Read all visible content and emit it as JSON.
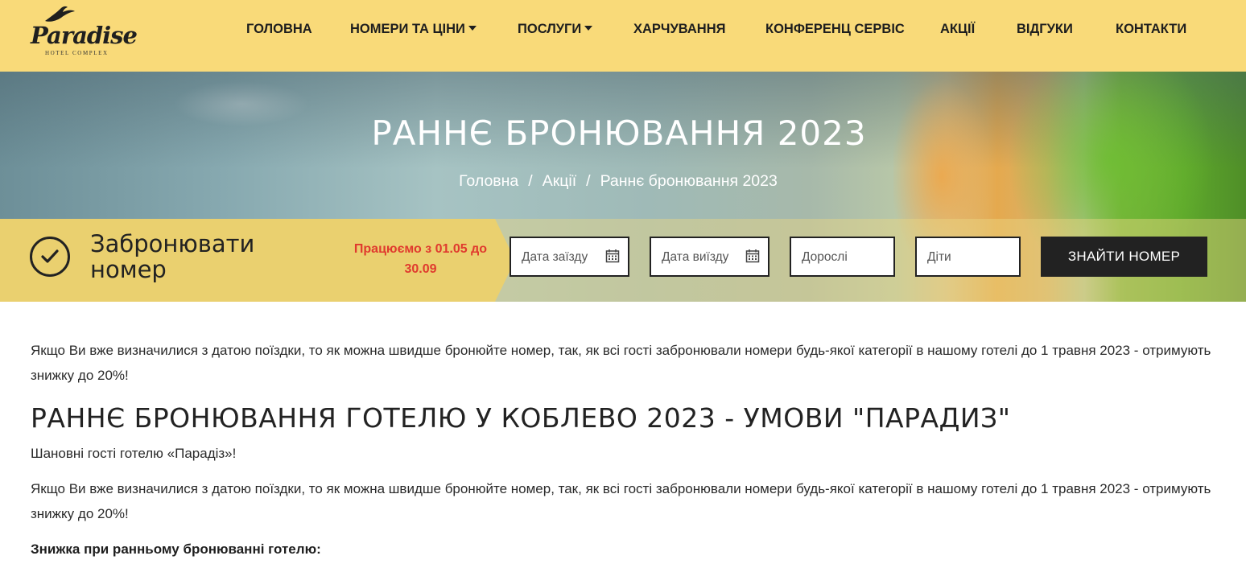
{
  "header": {
    "logo": {
      "word": "Paradise",
      "sub": "HOTEL COMPLEX"
    },
    "nav": [
      {
        "label": "ГОЛОВНА",
        "has_dropdown": false
      },
      {
        "label": "НОМЕРИ ТА ЦІНИ",
        "has_dropdown": true
      },
      {
        "label": "ПОСЛУГИ",
        "has_dropdown": true
      },
      {
        "label": "ХАРЧУВАННЯ",
        "has_dropdown": false
      },
      {
        "label": "КОНФЕРЕНЦ СЕРВІС",
        "has_dropdown": false
      },
      {
        "label": "АКЦІЇ",
        "has_dropdown": false
      },
      {
        "label": "ВІДГУКИ",
        "has_dropdown": false
      },
      {
        "label": "КОНТАКТИ",
        "has_dropdown": false
      }
    ]
  },
  "hero": {
    "title": "РАННЄ БРОНЮВАННЯ 2023",
    "breadcrumb": [
      "Головна",
      "Акції",
      "Раннє бронювання 2023"
    ],
    "separator": "/"
  },
  "booking": {
    "title_line1": "Забронювати",
    "title_line2": "номер",
    "notice": "Працюємо з 01.05 до 30.09",
    "checkin_placeholder": "Дата заїзду",
    "checkout_placeholder": "Дата виїзду",
    "adults_placeholder": "Дорослі",
    "children_placeholder": "Діти",
    "find_button": "ЗНАЙТИ НОМЕР"
  },
  "content": {
    "intro": "Якщо Ви вже визначилися з датою поїздки, то як можна швидше бронюйте номер, так, як всі гості забронювали номери будь-якої категорії в нашому готелі до 1 травня 2023 - отримують знижку до 20%!",
    "heading": "РАННЄ БРОНЮВАННЯ ГОТЕЛЮ У КОБЛЕВО 2023 - УМОВИ \"ПАРАДИЗ\"",
    "greeting": "Шановні гості готелю «Парадіз»!",
    "intro2": "Якщо Ви вже визначилися з датою поїздки, то як можна швидше бронюйте номер, так, як всі гості забронювали номери будь-якої категорії в нашому готелі до 1 травня 2023 - отримують знижку до 20%!",
    "discount_heading": "Знижка при ранньому бронюванні готелю:"
  },
  "colors": {
    "header_bg": "#f9da79",
    "booking_bg": "#ead06f",
    "notice": "#e03a2e",
    "button_bg": "#222222"
  }
}
